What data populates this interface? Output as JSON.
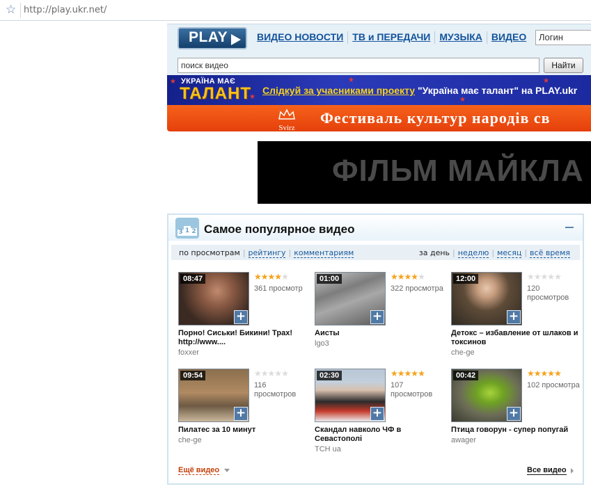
{
  "browser": {
    "url": "http://play.ukr.net/"
  },
  "header": {
    "logo": "PLAY",
    "nav": [
      "ВИДЕО НОВОСТИ",
      "ТВ и ПЕРЕДАЧИ",
      "МУЗЫКА",
      "ВИДЕО"
    ],
    "login_value": "Логин",
    "search_value": "поиск видео",
    "search_button": "Найти"
  },
  "banner1": {
    "logo_top": "УКРАЇНА МАЄ",
    "logo_main": "ТАЛАНТ",
    "text_link": "Слідкуй за учасниками проекту",
    "text_rest": " \"Україна має талант\" на PLAY.ukr"
  },
  "banner2": {
    "logo": "Svirz",
    "text": "Фестиваль культур народів св"
  },
  "film_banner": {
    "text": "ФІЛЬМ   МАЙКЛА М"
  },
  "popular": {
    "title": "Самое популярное видео",
    "icon_digits": [
      "3",
      "1",
      "2"
    ],
    "sort_left": [
      "по просмотрам",
      "рейтингу",
      "комментариям"
    ],
    "sort_right": [
      "за день",
      "неделю",
      "месяц",
      "всё время"
    ],
    "videos": [
      {
        "duration": "08:47",
        "rating": 4,
        "views": "361 просмотр",
        "title": "Порно! Сиськи! Бикини! Трах! http://www....",
        "author": "foxxer"
      },
      {
        "duration": "01:00",
        "rating": 4,
        "views": "322 просмотра",
        "title": "Аисты",
        "author": "lgo3"
      },
      {
        "duration": "12:00",
        "rating": 0,
        "views": "120 просмотров",
        "title": "Детокс – избавление от шлаков и токсинов",
        "author": "che-ge"
      },
      {
        "duration": "09:54",
        "rating": 0,
        "views": "116 просмотров",
        "title": "Пилатес за 10 минут",
        "author": "che-ge"
      },
      {
        "duration": "02:30",
        "rating": 5,
        "views": "107 просмотров",
        "title": "Скандал навколо ЧФ в Севастополі",
        "author": "ТСН ua"
      },
      {
        "duration": "00:42",
        "rating": 5,
        "views": "102 просмотра",
        "title": "Птица говорун - супер попугай",
        "author": "awager"
      }
    ],
    "more_label": "Ещё видео",
    "all_label": "Все видео"
  },
  "colors": {
    "link": "#13539b",
    "accent_orange": "#e5400b",
    "star_on": "#f7a21a"
  }
}
